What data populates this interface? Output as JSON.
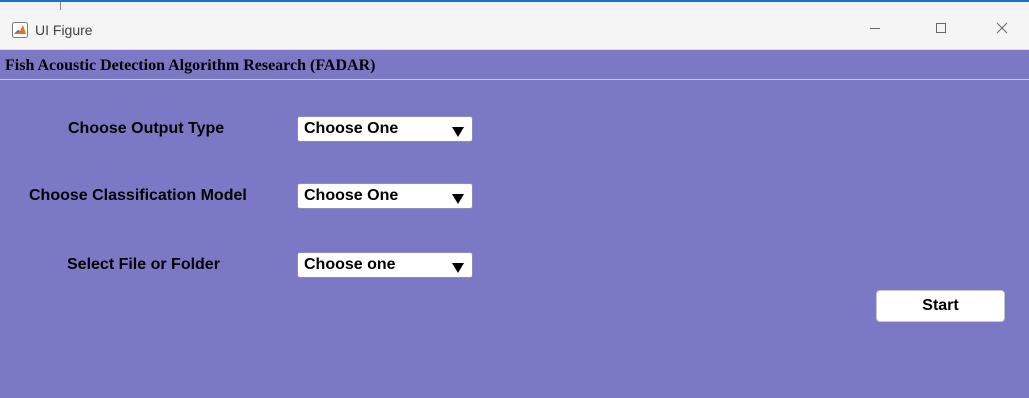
{
  "window": {
    "title": "UI Figure",
    "icon": "matlab-icon",
    "controls": {
      "minimize_icon": "minimize-icon",
      "maximize_icon": "maximize-icon",
      "close_icon": "close-icon"
    }
  },
  "colors": {
    "background": "#7b79c5",
    "titlebar": "#f5f5f5"
  },
  "header": {
    "title": "Fish Acoustic Detection Algorithm Research (FADAR)"
  },
  "form": {
    "output_type": {
      "label": "Choose Output Type",
      "value": "Choose One"
    },
    "classification_model": {
      "label": "Choose Classification Model",
      "value": "Choose One"
    },
    "file_folder": {
      "label": "Select  File or Folder",
      "value": "Choose one"
    }
  },
  "actions": {
    "start_label": "Start"
  }
}
